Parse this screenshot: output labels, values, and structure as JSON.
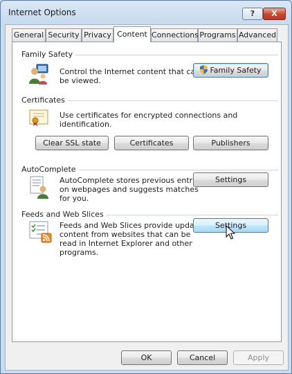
{
  "window": {
    "title": "Internet Options"
  },
  "titlebar_buttons": {
    "help": "?",
    "close": "X"
  },
  "tabs": [
    {
      "label": "General"
    },
    {
      "label": "Security"
    },
    {
      "label": "Privacy"
    },
    {
      "label": "Content",
      "active": true
    },
    {
      "label": "Connections"
    },
    {
      "label": "Programs"
    },
    {
      "label": "Advanced"
    }
  ],
  "family_safety": {
    "heading": "Family Safety",
    "desc_line1": "Control the Internet content that can",
    "desc_line2": "be viewed.",
    "button": "Family Safety"
  },
  "certificates": {
    "heading": "Certificates",
    "desc": "Use certificates for encrypted connections and identification.",
    "buttons": {
      "clear_ssl": "Clear SSL state",
      "certificates": "Certificates",
      "publishers": "Publishers"
    }
  },
  "autocomplete": {
    "heading": "AutoComplete",
    "desc_line1": "AutoComplete stores previous entries",
    "desc_line2": "on webpages and suggests matches",
    "desc_line3": "for you.",
    "button": "Settings"
  },
  "feeds": {
    "heading": "Feeds and Web Slices",
    "desc_line1": "Feeds and Web Slices provide updated",
    "desc_line2": "content from websites that can be",
    "desc_line3": "read in Internet Explorer and other",
    "desc_line4": "programs.",
    "button": "Settings"
  },
  "footer": {
    "ok": "OK",
    "cancel": "Cancel",
    "apply": "Apply"
  },
  "colors": {
    "title_bg": "#c9dbef",
    "close_red": "#c8452f",
    "hover_blue": "#bee6fd"
  }
}
